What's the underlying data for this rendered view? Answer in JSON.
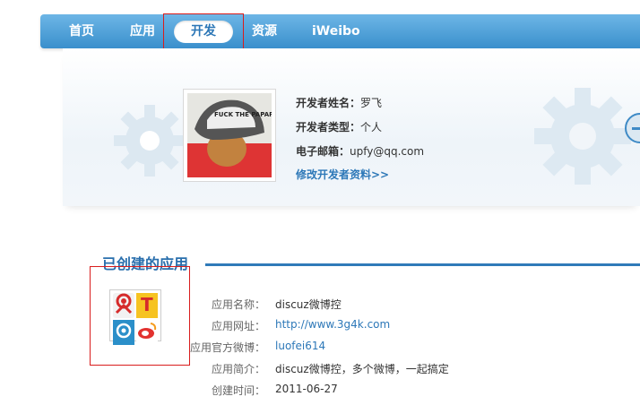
{
  "nav": {
    "items": [
      {
        "label": "首页"
      },
      {
        "label": "应用"
      },
      {
        "label": "开发"
      },
      {
        "label": "资源"
      },
      {
        "label": "iWeibo"
      }
    ],
    "active_index": 2
  },
  "developer": {
    "name_label": "开发者姓名：",
    "name_value": "罗飞",
    "type_label": "开发者类型：",
    "type_value": "个人",
    "email_label": "电子邮箱：",
    "email_value": "upfy@qq.com",
    "edit_link": "修改开发者资料>>",
    "avatar_text": "FUCK THE PAPARAZZI"
  },
  "section": {
    "title": "已创建的应用"
  },
  "app": {
    "fields": [
      {
        "label": "应用名称：",
        "value": "discuz微博控"
      },
      {
        "label": "应用网址：",
        "value": "http://www.3g4k.com"
      },
      {
        "label": "应用官方微博：",
        "value": "luofei614"
      },
      {
        "label": "应用简介：",
        "value": "discuz微博控，多个微博，一起搞定"
      },
      {
        "label": "创建时间：",
        "value": "2011-06-27"
      }
    ]
  },
  "colors": {
    "nav_top": "#6db6e6",
    "nav_bottom": "#3a8fcc",
    "link": "#2d78b8",
    "section_title": "#2a6fad",
    "highlight_box": "#d91d1d"
  }
}
